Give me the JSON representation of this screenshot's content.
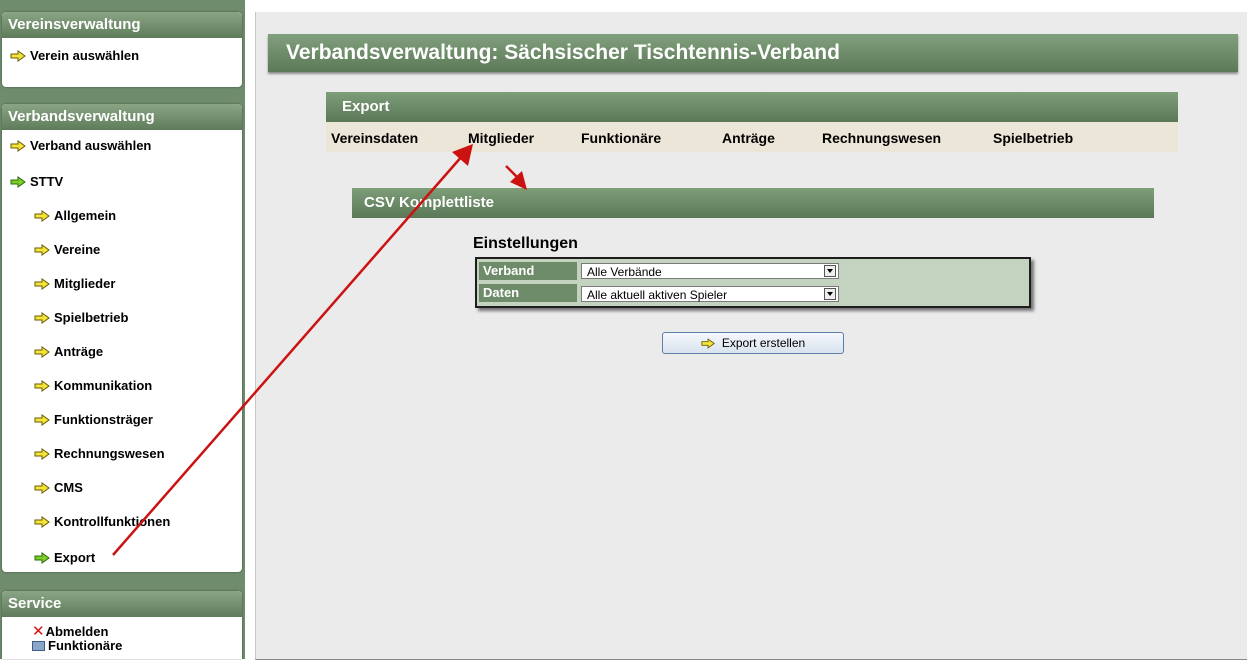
{
  "sidebar": {
    "vereinsverwaltung": {
      "title": "Vereinsverwaltung",
      "items": [
        {
          "label": "Verein auswählen"
        }
      ]
    },
    "verbandsverwaltung": {
      "title": "Verbandsverwaltung",
      "items": [
        {
          "label": "Verband auswählen"
        },
        {
          "label": "STTV"
        },
        {
          "label": "Allgemein"
        },
        {
          "label": "Vereine"
        },
        {
          "label": "Mitglieder"
        },
        {
          "label": "Spielbetrieb"
        },
        {
          "label": "Anträge"
        },
        {
          "label": "Kommunikation"
        },
        {
          "label": "Funktionsträger"
        },
        {
          "label": "Rechnungswesen"
        },
        {
          "label": "CMS"
        },
        {
          "label": "Kontrollfunktionen"
        },
        {
          "label": "Export"
        }
      ]
    },
    "service": {
      "title": "Service",
      "items": [
        {
          "label": "Abmelden"
        },
        {
          "label": "Funktionäre"
        }
      ]
    }
  },
  "main": {
    "page_title": "Verbandsverwaltung: Sächsischer Tischtennis-Verband",
    "export_title": "Export",
    "tabs": [
      {
        "label": "Vereinsdaten"
      },
      {
        "label": "Mitglieder"
      },
      {
        "label": "Funktionäre"
      },
      {
        "label": "Anträge"
      },
      {
        "label": "Rechnungswesen"
      },
      {
        "label": "Spielbetrieb"
      }
    ],
    "section_title": "CSV Komplettliste",
    "settings": {
      "title": "Einstellungen",
      "verband_label": "Verband",
      "verband_value": "Alle Verbände",
      "daten_label": "Daten",
      "daten_value": "Alle aktuell aktiven Spieler"
    },
    "export_button": "Export erstellen"
  },
  "colors": {
    "header_green": "#6f8c6a",
    "arrow_yellow": "#f5e53a",
    "arrow_green": "#7ccf2a",
    "annotation_red": "#cc1111"
  }
}
